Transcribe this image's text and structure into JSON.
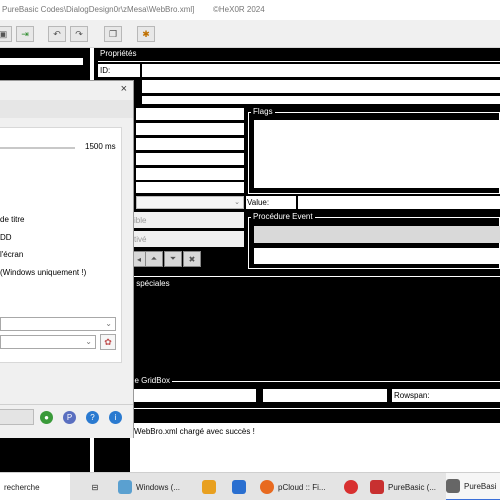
{
  "window": {
    "title": "PureBasic Codes\\DialogDesign0r\\zMesa\\WebBro.xml]",
    "copyright": "©HeX0R 2024"
  },
  "properties": {
    "header": "Propriétés",
    "id_label": "ID:",
    "value_label": "Value:",
    "flags_label": "Flags",
    "event_label": "Procédure Event",
    "special_label": "s spéciales",
    "gridbox_label": "de GridBox",
    "rowspan_label": "Rowspan:",
    "visible_fragment": "ible",
    "active_fragment": "tivé"
  },
  "dialog": {
    "close_glyph": "×",
    "slider_value": "1500 ms",
    "options": [
      "de titre",
      "DD",
      "l'écran",
      "(Windows uniquement !)"
    ]
  },
  "status": {
    "message": "WebBro.xml chargé avec succès !"
  },
  "taskbar": {
    "search": "recherche",
    "items": [
      {
        "label": "Windows (...",
        "active": false
      },
      {
        "label": "pCloud :: Fi...",
        "active": false
      },
      {
        "label": "PureBasic (...",
        "active": false
      },
      {
        "label": "PureBasi",
        "active": true
      }
    ]
  }
}
